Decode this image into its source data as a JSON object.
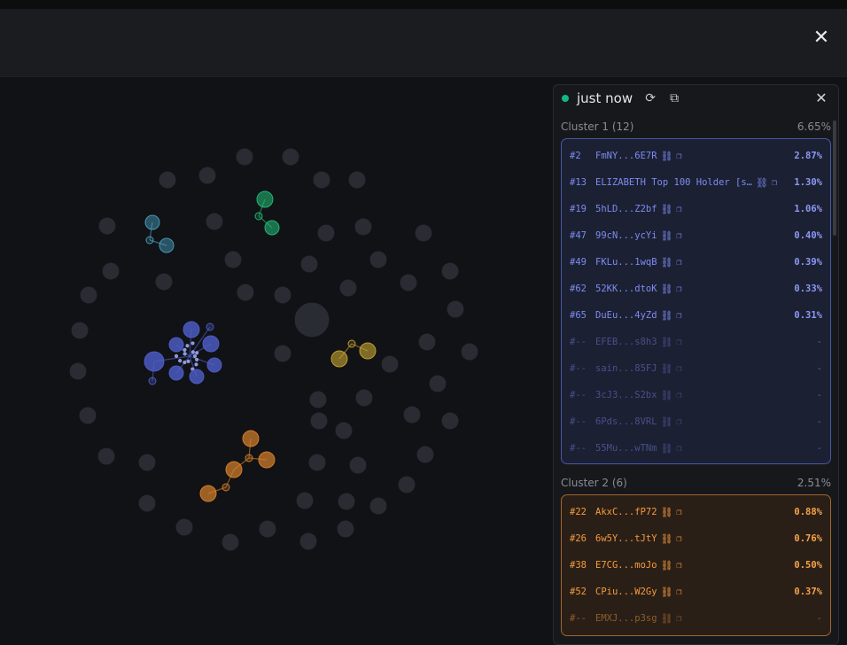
{
  "window": {
    "close_label": "✕"
  },
  "panel": {
    "status": "just now",
    "icons": [
      "refresh-icon",
      "external-link-icon"
    ],
    "close_label": "✕",
    "live_color": "#10b981"
  },
  "clusters": [
    {
      "title": "Cluster 1 (12)",
      "percent": "6.65%",
      "accent": "#6272e0",
      "rows": [
        {
          "rank": "#2",
          "address": "FmNY...6E7R",
          "percent": "2.87%"
        },
        {
          "rank": "#13",
          "address": "ELIZABETH Top 100 Holder [s…",
          "percent": "1.30%"
        },
        {
          "rank": "#19",
          "address": "5hLD...Z2bf",
          "percent": "1.06%"
        },
        {
          "rank": "#47",
          "address": "99cN...ycYi",
          "percent": "0.40%"
        },
        {
          "rank": "#49",
          "address": "FKLu...1wqB",
          "percent": "0.39%"
        },
        {
          "rank": "#62",
          "address": "52KK...dtoK",
          "percent": "0.33%"
        },
        {
          "rank": "#65",
          "address": "DuEu...4yZd",
          "percent": "0.31%"
        },
        {
          "rank": "#--",
          "address": "EFEB...s8h3",
          "percent": "-"
        },
        {
          "rank": "#--",
          "address": "sain...85FJ",
          "percent": "-"
        },
        {
          "rank": "#--",
          "address": "3cJ3...S2bx",
          "percent": "-"
        },
        {
          "rank": "#--",
          "address": "6Pds...8VRL",
          "percent": "-"
        },
        {
          "rank": "#--",
          "address": "55Mu...wTNm",
          "percent": "-"
        }
      ]
    },
    {
      "title": "Cluster 2 (6)",
      "percent": "2.51%",
      "accent": "#f59b3c",
      "rows": [
        {
          "rank": "#22",
          "address": "AkxC...fP72",
          "percent": "0.88%"
        },
        {
          "rank": "#26",
          "address": "6w5Y...tJtY",
          "percent": "0.76%"
        },
        {
          "rank": "#38",
          "address": "E7CG...moJo",
          "percent": "0.50%"
        },
        {
          "rank": "#52",
          "address": "CPiu...W2Gy",
          "percent": "0.37%"
        },
        {
          "rank": "#--",
          "address": "EMXJ...p3sg",
          "percent": "-"
        }
      ]
    }
  ],
  "graph": {
    "node_colors": {
      "default": "#2a2c33",
      "blue": "#4f5fcc",
      "teal": "#4aa3c4",
      "green": "#22c07a",
      "yellow": "#c9a632",
      "orange": "#d9822b"
    }
  }
}
